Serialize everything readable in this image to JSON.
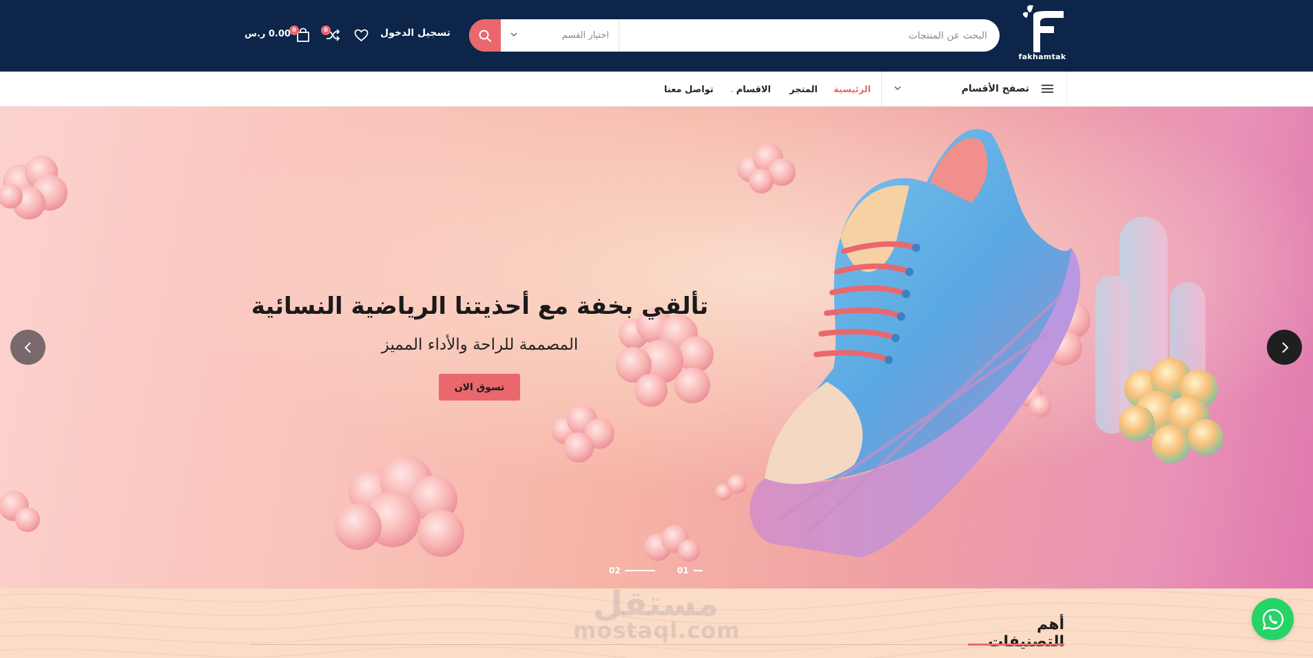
{
  "brand": {
    "name": "fakhamtak",
    "accent_color": "#e9686d",
    "header_color": "#0c2549",
    "whatsapp_color": "#25d366"
  },
  "header": {
    "search_placeholder": "البحث عن المنتجات",
    "category_select": "اختيار القسم",
    "login_label": "تسجيل الدخول",
    "compare_count": "0",
    "cart_count": "0",
    "cart_total": "0.00 ر.س"
  },
  "nav": {
    "browse_label": "تصفح الأقسام",
    "links": [
      "الرئيسية",
      "المتجر",
      "الاقسام",
      "تواصل معنا"
    ],
    "active_link": "الرئيسية"
  },
  "hero": {
    "title": "تألقي بخفة مع أحذيتنا الرياضية النسائية",
    "subtitle": "المصممة للراحة والأداء المميز",
    "cta_label": "تسوق الان",
    "slides": [
      "01",
      "02"
    ],
    "active_slide": "01"
  },
  "categories": {
    "title": "أهم التصنيفات"
  },
  "watermark": {
    "arabic": "مستقل",
    "latin": "mostaql.com"
  },
  "icons": {
    "search": "search-icon",
    "wishlist": "heart-icon",
    "compare": "shuffle-icon",
    "cart": "shopping-bag-icon",
    "menu": "hamburger-icon",
    "whatsapp": "whatsapp-icon"
  }
}
